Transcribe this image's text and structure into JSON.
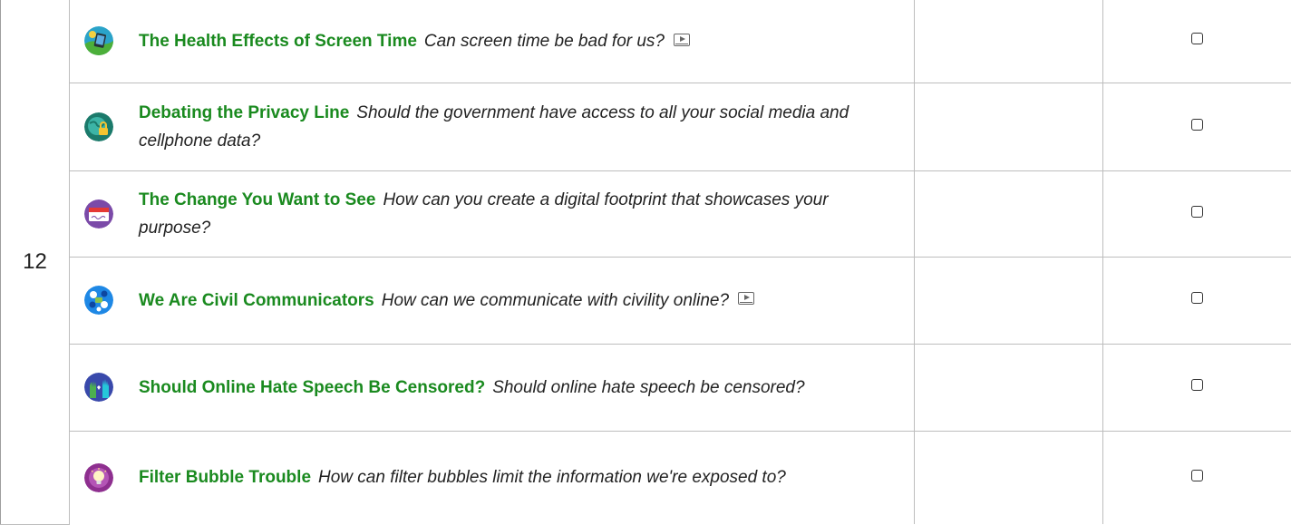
{
  "grade": "12",
  "lessons": [
    {
      "title": "The Health Effects of Screen Time",
      "question": "Can screen time be bad for us?",
      "has_video": true,
      "icon": "screen-time-icon"
    },
    {
      "title": "Debating the Privacy Line",
      "question": "Should the government have access to all your social media and cellphone data?",
      "has_video": false,
      "icon": "privacy-lock-globe-icon"
    },
    {
      "title": "The Change You Want to See",
      "question": "How can you create a digital footprint that showcases your purpose?",
      "has_video": false,
      "icon": "name-tag-icon"
    },
    {
      "title": "We Are Civil Communicators",
      "question": "How can we communicate with civility online?",
      "has_video": true,
      "icon": "speech-bubbles-icon"
    },
    {
      "title": "Should Online Hate Speech Be Censored?",
      "question": "Should online hate speech be censored?",
      "has_video": false,
      "icon": "raised-hands-icon"
    },
    {
      "title": "Filter Bubble Trouble",
      "question": "How can filter bubbles limit the information we're exposed to?",
      "has_video": false,
      "icon": "lightbulb-icon"
    }
  ]
}
